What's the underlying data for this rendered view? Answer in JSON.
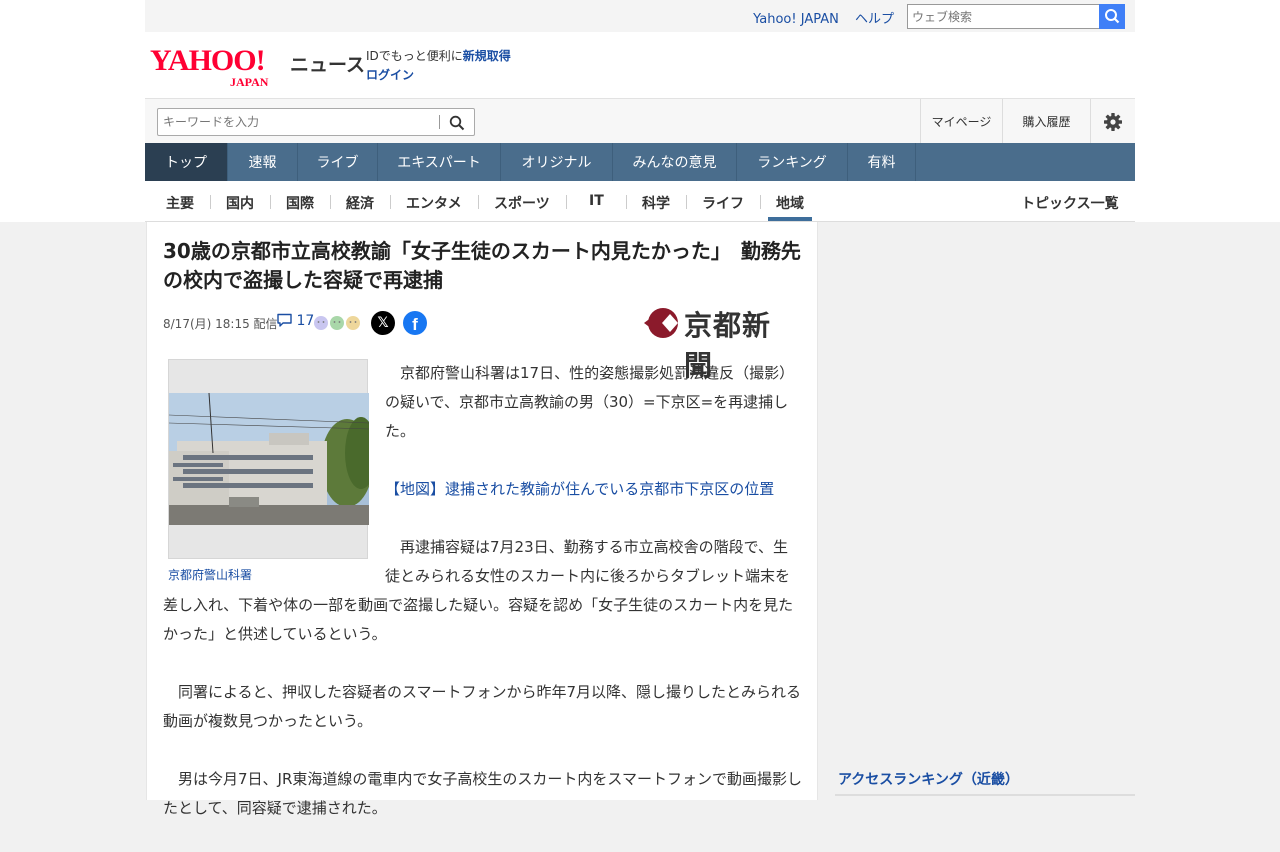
{
  "util": {
    "yahoo_japan": "Yahoo! JAPAN",
    "help": "ヘルプ",
    "web_search_placeholder": "ウェブ検索"
  },
  "header": {
    "logo_main": "YAHOO!",
    "logo_sub": "JAPAN",
    "section": "ニュース",
    "id_promo": "IDでもっと便利に",
    "signup": "新規取得",
    "login": "ログイン"
  },
  "search": {
    "placeholder": "キーワードを入力",
    "mypage": "マイページ",
    "history": "購入履歴"
  },
  "main_nav": [
    {
      "label": "トップ"
    },
    {
      "label": "速報"
    },
    {
      "label": "ライブ"
    },
    {
      "label": "エキスパート"
    },
    {
      "label": "オリジナル"
    },
    {
      "label": "みんなの意見"
    },
    {
      "label": "ランキング"
    },
    {
      "label": "有料"
    }
  ],
  "sub_nav": [
    {
      "label": "主要"
    },
    {
      "label": "国内"
    },
    {
      "label": "国際"
    },
    {
      "label": "経済"
    },
    {
      "label": "エンタメ"
    },
    {
      "label": "スポーツ"
    },
    {
      "label": "IT"
    },
    {
      "label": "科学"
    },
    {
      "label": "ライフ"
    },
    {
      "label": "地域"
    }
  ],
  "topics_all": "トピックス一覧",
  "article": {
    "title": "30歳の京都市立高校教諭「女子生徒のスカート内見たかった」　勤務先の校内で盗撮した容疑で再逮捕",
    "date": "8/17(月) 18:15",
    "distributed": "配信",
    "comments": "17",
    "publisher": "京都新聞",
    "photo_caption": "京都府警山科署",
    "paragraphs": [
      "京都府警山科署は17日、性的姿態撮影処罰法違反（撮影）の疑いで、京都市立高教諭の男（30）=下京区=を再逮捕した。",
      "【地図】逮捕された教諭が住んでいる京都市下京区の位置",
      "再逮捕容疑は7月23日、勤務する市立高校舎の階段で、生徒とみられる女性のスカート内に後ろからタブレット端末を差し入れ、下着や体の一部を動画で盗撮した疑い。容疑を認め「女子生徒のスカート内を見たかった」と供述しているという。",
      "同署によると、押収した容疑者のスマートフォンから昨年7月以降、隠し撮りしたとみられる動画が複数見つかったという。",
      "男は今月7日、JR東海道線の電車内で女子高校生のスカート内をスマートフォンで動画撮影したとして、同容疑で逮捕された。"
    ]
  },
  "sidebar": {
    "ranking_title": "アクセスランキング（近畿）"
  },
  "colors": {
    "yahoo_red": "#ff0033",
    "link_blue": "#1a4ea3",
    "nav_bg": "#4a6d8c",
    "nav_active": "#2b3f52",
    "publisher_mark": "#8b1a2b"
  }
}
